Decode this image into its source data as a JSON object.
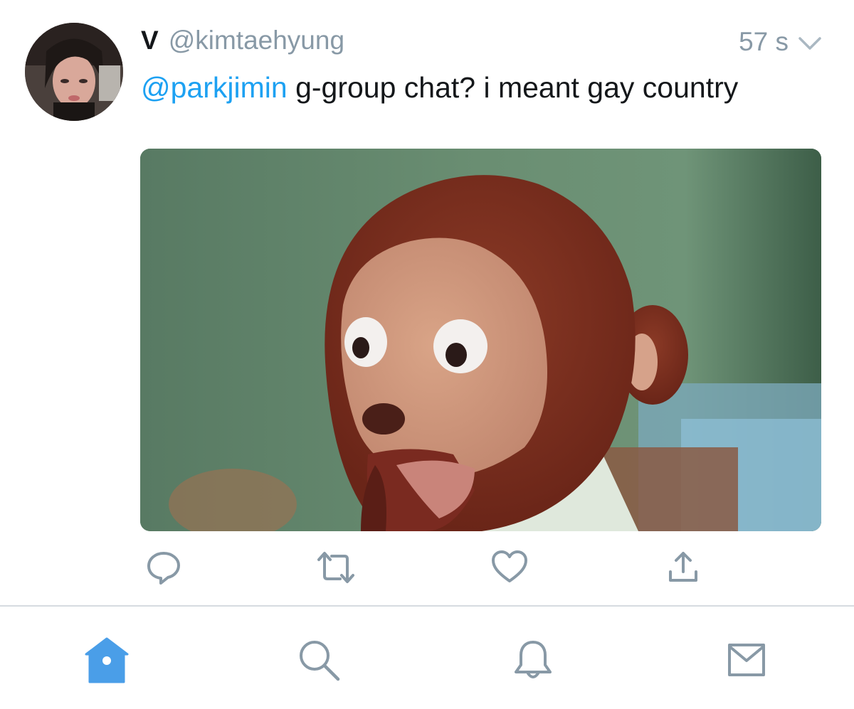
{
  "tweet": {
    "display_name": "V",
    "handle": "@kimtaehyung",
    "timestamp": "57 s",
    "mention": "@parkjimin",
    "text": " g-group chat? i meant gay country",
    "avatar_icon": "profile-photo",
    "media_icon": "monkey-puppet-image"
  },
  "actions": [
    {
      "name": "reply",
      "icon": "reply-icon"
    },
    {
      "name": "retweet",
      "icon": "retweet-icon"
    },
    {
      "name": "like",
      "icon": "heart-icon"
    },
    {
      "name": "share",
      "icon": "share-icon"
    }
  ],
  "tabbar": [
    {
      "name": "home",
      "icon": "home-icon",
      "active": true
    },
    {
      "name": "search",
      "icon": "search-icon",
      "active": false
    },
    {
      "name": "notifications",
      "icon": "bell-icon",
      "active": false
    },
    {
      "name": "messages",
      "icon": "mail-icon",
      "active": false
    }
  ],
  "colors": {
    "accent": "#1da1f2",
    "tab_active": "#4a9ee8",
    "icon_gray": "#8899a6",
    "text": "#14171a",
    "divider": "#d6dbe0"
  }
}
